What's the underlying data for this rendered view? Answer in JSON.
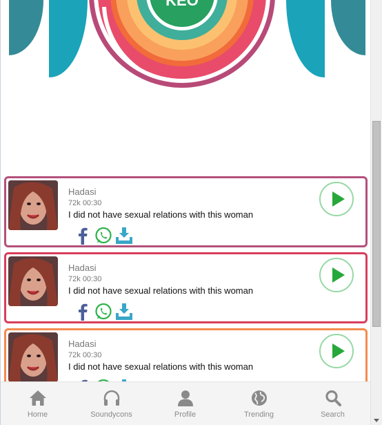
{
  "hero": {
    "badge_text": "KEO"
  },
  "tracks": [
    {
      "author": "Hadasi",
      "plays": "72k",
      "duration": "00:30",
      "title": "I did not have sexual relations with this woman"
    },
    {
      "author": "Hadasi",
      "plays": "72k",
      "duration": "00:30",
      "title": "I did not have sexual relations with this woman"
    },
    {
      "author": "Hadasi",
      "plays": "72k",
      "duration": "00:30",
      "title": "I did not have sexual relations with this woman"
    }
  ],
  "card_colors": [
    "#b3507b",
    "#d83d5c",
    "#f58b4e"
  ],
  "icons": {
    "share": "facebook-icon",
    "whatsapp": "whatsapp-icon",
    "download": "download-icon",
    "play": "play-icon"
  },
  "nav": [
    {
      "label": "Home",
      "icon": "home-icon"
    },
    {
      "label": "Soundycons",
      "icon": "headphones-icon"
    },
    {
      "label": "Profile",
      "icon": "user-icon"
    },
    {
      "label": "Trending",
      "icon": "globe-icon"
    },
    {
      "label": "Search",
      "icon": "search-icon"
    }
  ]
}
